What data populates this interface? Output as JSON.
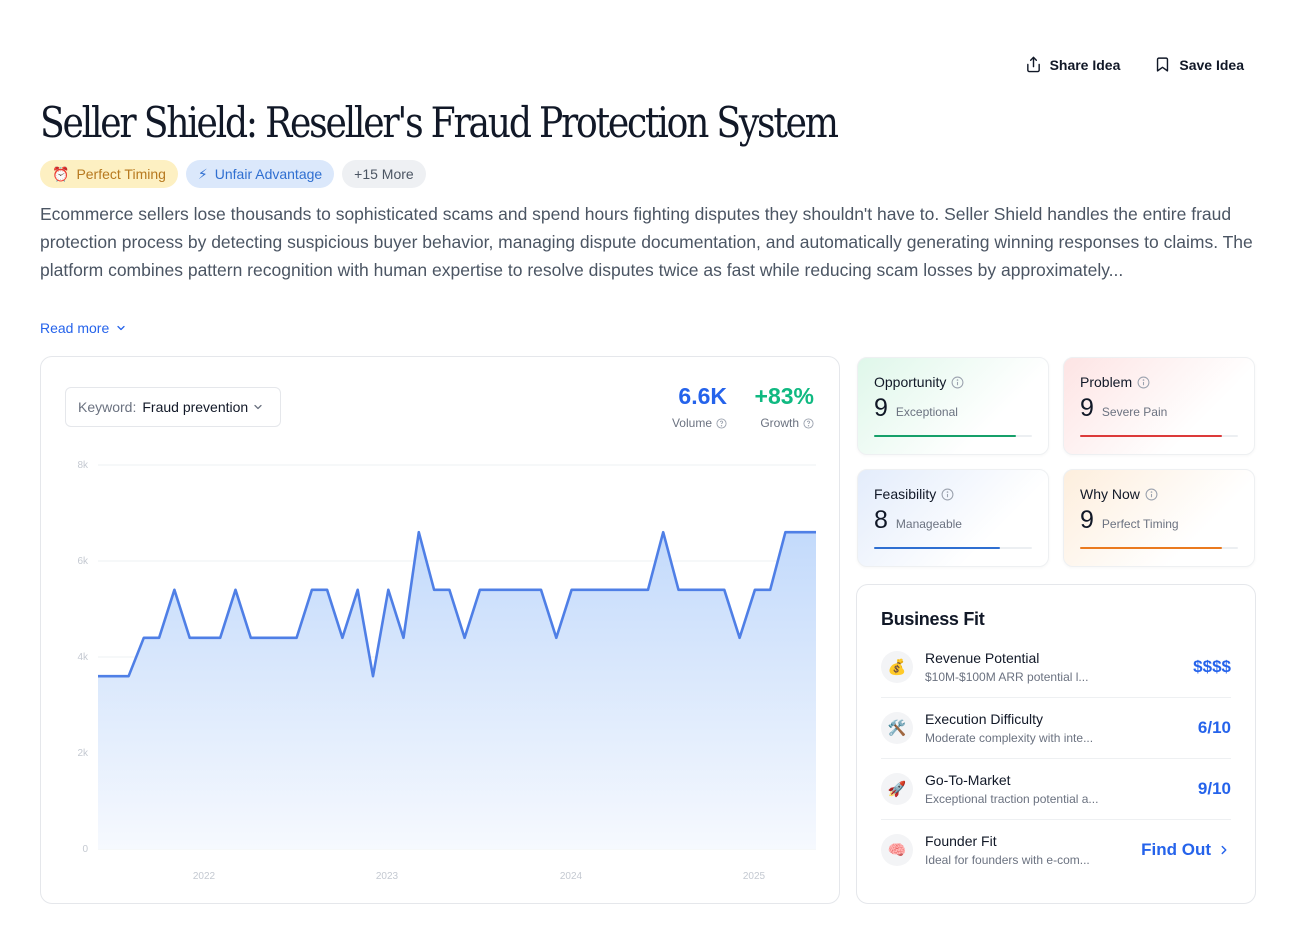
{
  "actions": {
    "share": "Share Idea",
    "save": "Save Idea"
  },
  "title": "Seller Shield: Reseller's Fraud Protection System",
  "tags": [
    {
      "icon": "⏰",
      "label": "Perfect Timing"
    },
    {
      "icon": "⚡",
      "label": "Unfair Advantage"
    },
    {
      "label": "+15 More"
    }
  ],
  "description": "Ecommerce sellers lose thousands to sophisticated scams and spend hours fighting disputes they shouldn't have to. Seller Shield handles the entire fraud protection process by detecting suspicious buyer behavior, managing dispute documentation, and automatically generating winning responses to claims. The platform combines pattern recognition with human expertise to resolve disputes twice as fast while reducing scam losses by approximately...",
  "read_more": "Read more",
  "keyword": {
    "label": "Keyword:",
    "value": "Fraud prevention"
  },
  "metrics": {
    "volume": {
      "value": "6.6K",
      "label": "Volume"
    },
    "growth": {
      "value": "+83%",
      "label": "Growth"
    }
  },
  "chart_data": {
    "type": "area",
    "x_ticks": [
      "2022",
      "2023",
      "2024",
      "2025"
    ],
    "y_ticks": [
      "0",
      "2k",
      "4k",
      "6k",
      "8k"
    ],
    "ylim": [
      0,
      8000
    ],
    "color": "#4f7fe6",
    "values": [
      3600,
      3600,
      3600,
      4400,
      4400,
      5400,
      4400,
      4400,
      4400,
      5400,
      4400,
      4400,
      4400,
      4400,
      5400,
      5400,
      4400,
      5400,
      3600,
      5400,
      4400,
      6600,
      5400,
      5400,
      4400,
      5400,
      5400,
      5400,
      5400,
      5400,
      4400,
      5400,
      5400,
      5400,
      5400,
      5400,
      5400,
      6600,
      5400,
      5400,
      5400,
      5400,
      4400,
      5400,
      5400,
      6600,
      6600,
      6600
    ]
  },
  "scores": {
    "opportunity": {
      "label": "Opportunity",
      "value": "9",
      "desc": "Exceptional",
      "fraction": 0.9,
      "color": "#16a06a"
    },
    "problem": {
      "label": "Problem",
      "value": "9",
      "desc": "Severe Pain",
      "fraction": 0.9,
      "color": "#dc3a3a"
    },
    "feasibility": {
      "label": "Feasibility",
      "value": "8",
      "desc": "Manageable",
      "fraction": 0.8,
      "color": "#2f6fd1"
    },
    "why_now": {
      "label": "Why Now",
      "value": "9",
      "desc": "Perfect Timing",
      "fraction": 0.9,
      "color": "#ea7a1f"
    }
  },
  "business_fit": {
    "title": "Business Fit",
    "rows": [
      {
        "icon": "💰",
        "name": "Revenue Potential",
        "sub": "$10M-$100M ARR potential l...",
        "value": "$$$$"
      },
      {
        "icon": "🛠️",
        "name": "Execution Difficulty",
        "sub": "Moderate complexity with inte...",
        "value": "6/10"
      },
      {
        "icon": "🚀",
        "name": "Go-To-Market",
        "sub": "Exceptional traction potential a...",
        "value": "9/10"
      },
      {
        "icon": "🧠",
        "name": "Founder Fit",
        "sub": "Ideal for founders with e-com...",
        "value": "Find Out"
      }
    ]
  }
}
